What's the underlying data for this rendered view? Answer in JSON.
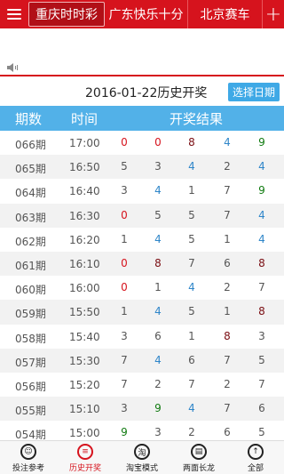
{
  "colors": {
    "primary_red": "#d6131d",
    "header_blue": "#52b1e8",
    "button_blue": "#3fa9e6",
    "num_red": "#d6131d",
    "num_blue": "#2f86c9",
    "num_dark": "#7a0d12",
    "num_green": "#0f7a0f",
    "num_gray": "#555555"
  },
  "nav": {
    "tabs": [
      "重庆时时彩",
      "广东快乐十分",
      "北京赛车"
    ],
    "menu_icon": "menu-icon",
    "plus_icon": "plus-icon"
  },
  "date_bar": {
    "title": "2016-01-22历史开奖",
    "button": "选择日期"
  },
  "table": {
    "headers": [
      "期数",
      "时间",
      "开奖结果"
    ],
    "rows": [
      {
        "qi": "066期",
        "time": "17:00",
        "nums": [
          "0",
          "0",
          "8",
          "4",
          "9"
        ],
        "colors": [
          "red",
          "red",
          "dark",
          "blue",
          "green"
        ]
      },
      {
        "qi": "065期",
        "time": "16:50",
        "nums": [
          "5",
          "3",
          "4",
          "2",
          "4"
        ],
        "colors": [
          "gray",
          "gray",
          "blue",
          "gray",
          "blue"
        ]
      },
      {
        "qi": "064期",
        "time": "16:40",
        "nums": [
          "3",
          "4",
          "1",
          "7",
          "9"
        ],
        "colors": [
          "gray",
          "blue",
          "gray",
          "gray",
          "green"
        ]
      },
      {
        "qi": "063期",
        "time": "16:30",
        "nums": [
          "0",
          "5",
          "5",
          "7",
          "4"
        ],
        "colors": [
          "red",
          "gray",
          "gray",
          "gray",
          "blue"
        ]
      },
      {
        "qi": "062期",
        "time": "16:20",
        "nums": [
          "1",
          "4",
          "5",
          "1",
          "4"
        ],
        "colors": [
          "gray",
          "blue",
          "gray",
          "gray",
          "blue"
        ]
      },
      {
        "qi": "061期",
        "time": "16:10",
        "nums": [
          "0",
          "8",
          "7",
          "6",
          "8"
        ],
        "colors": [
          "red",
          "dark",
          "gray",
          "gray",
          "dark"
        ]
      },
      {
        "qi": "060期",
        "time": "16:00",
        "nums": [
          "0",
          "1",
          "4",
          "2",
          "7"
        ],
        "colors": [
          "red",
          "gray",
          "blue",
          "gray",
          "gray"
        ]
      },
      {
        "qi": "059期",
        "time": "15:50",
        "nums": [
          "1",
          "4",
          "5",
          "1",
          "8"
        ],
        "colors": [
          "gray",
          "blue",
          "gray",
          "gray",
          "dark"
        ]
      },
      {
        "qi": "058期",
        "time": "15:40",
        "nums": [
          "3",
          "6",
          "1",
          "8",
          "3"
        ],
        "colors": [
          "gray",
          "gray",
          "gray",
          "dark",
          "gray"
        ]
      },
      {
        "qi": "057期",
        "time": "15:30",
        "nums": [
          "7",
          "4",
          "6",
          "7",
          "5"
        ],
        "colors": [
          "gray",
          "blue",
          "gray",
          "gray",
          "gray"
        ]
      },
      {
        "qi": "056期",
        "time": "15:20",
        "nums": [
          "7",
          "2",
          "7",
          "2",
          "7"
        ],
        "colors": [
          "gray",
          "gray",
          "gray",
          "gray",
          "gray"
        ]
      },
      {
        "qi": "055期",
        "time": "15:10",
        "nums": [
          "3",
          "9",
          "4",
          "7",
          "6"
        ],
        "colors": [
          "gray",
          "green",
          "blue",
          "gray",
          "gray"
        ]
      },
      {
        "qi": "054期",
        "time": "15:00",
        "nums": [
          "9",
          "3",
          "2",
          "6",
          "5"
        ],
        "colors": [
          "green",
          "gray",
          "gray",
          "gray",
          "gray"
        ]
      }
    ]
  },
  "bottom_nav": [
    {
      "label": "投注参考",
      "icon": "chat-icon",
      "glyph": "☺",
      "active": false
    },
    {
      "label": "历史开奖",
      "icon": "list-icon",
      "glyph": "≡",
      "active": true
    },
    {
      "label": "淘宝模式",
      "icon": "taobao-icon",
      "glyph": "淘",
      "active": false
    },
    {
      "label": "两面长龙",
      "icon": "document-icon",
      "glyph": "▤",
      "active": false
    },
    {
      "label": "全部",
      "icon": "arrow-up-icon",
      "glyph": "↑",
      "active": false
    }
  ]
}
